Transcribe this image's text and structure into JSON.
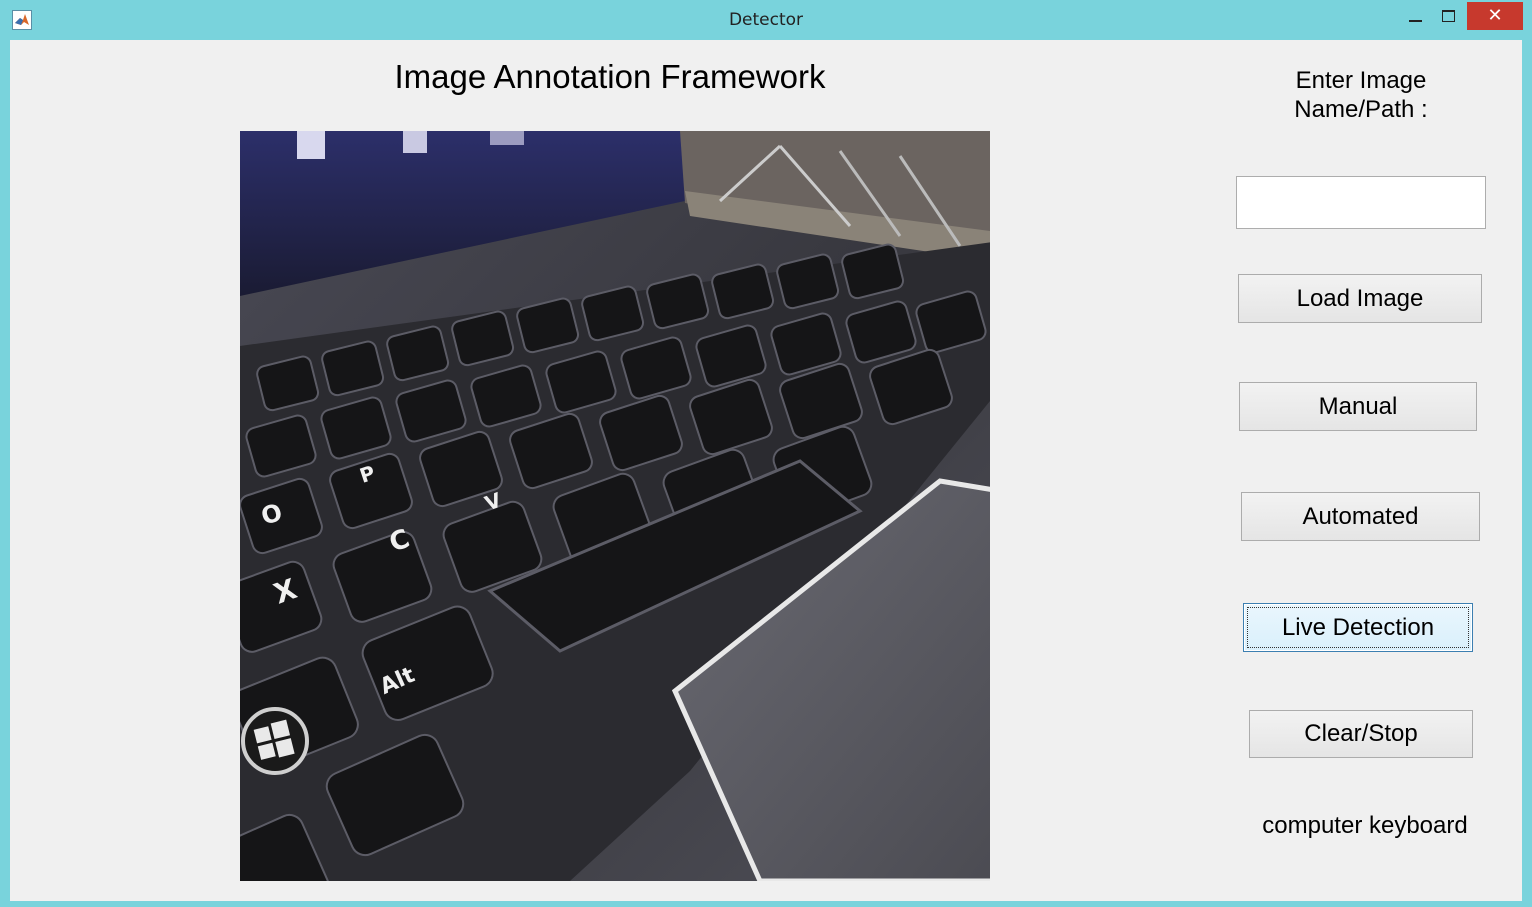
{
  "window": {
    "title": "Detector",
    "close_glyph": "✕",
    "icons": [
      "matlab-logo-icon",
      "minimize-icon",
      "maximize-icon",
      "close-icon"
    ]
  },
  "main": {
    "heading": "Image Annotation Framework",
    "image": {
      "subject": "laptop keyboard webcam capture",
      "key_labels": [
        "O",
        "C",
        "X",
        "Alt",
        "P",
        "V"
      ]
    }
  },
  "sidebar": {
    "path_label": "Enter Image\nName/Path :",
    "path_input_value": "",
    "buttons": {
      "load": "Load Image",
      "manual": "Manual",
      "automated": "Automated",
      "live": "Live Detection",
      "clear": "Clear/Stop"
    },
    "result_text": "computer keyboard"
  },
  "colors": {
    "title_bar": "#79d3dc",
    "client_bg": "#f0f0f0",
    "close_button": "#c7392d",
    "focused_button_border": "#3c7fb1"
  }
}
